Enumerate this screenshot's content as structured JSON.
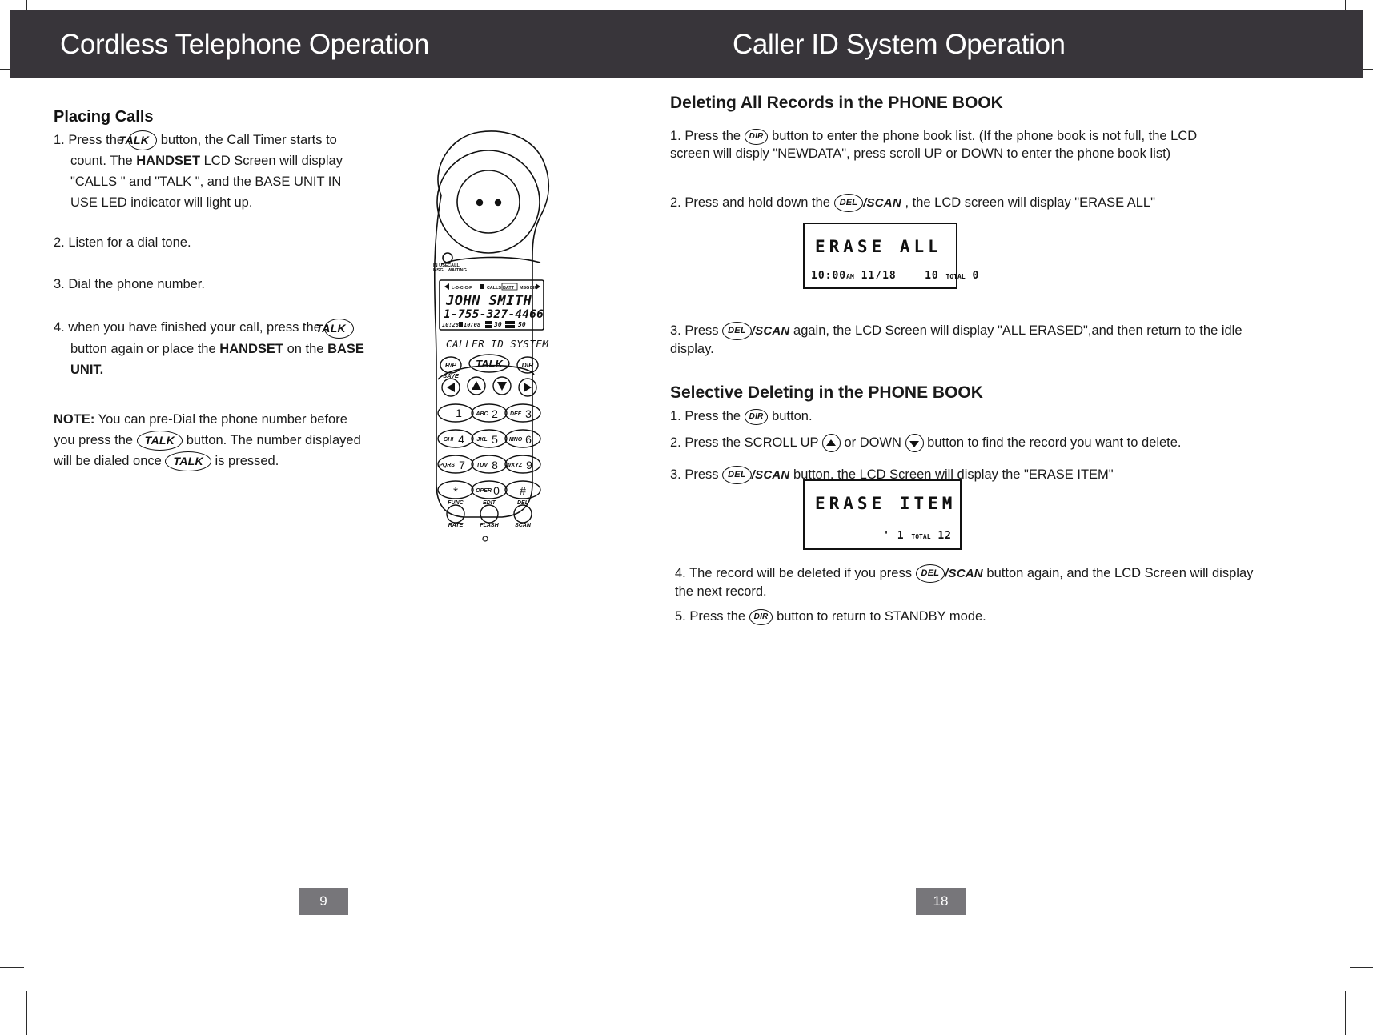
{
  "headers": {
    "left": "Cordless Telephone Operation",
    "right": "Caller ID System Operation"
  },
  "left_page": {
    "section_title": "Placing Calls",
    "step1": {
      "num": "1.",
      "a": "Press the",
      "btn": "TALK",
      "b": "button,   the   Call   Timer starts to count. The",
      "bold1": "HANDSET",
      "c": "LCD Screen will display \"CALLS \"  and  \"TALK \", and  the BASE  UNIT  IN USE LED indicator will light up."
    },
    "step2": "2. Listen for a dial tone.",
    "step3": "3. Dial the phone number.",
    "step4": {
      "num": "4.",
      "a": "when you have finished your call, press the",
      "btn": "TALK",
      "b": "button again or place the",
      "bold1": "HANDSET",
      "c": "on the",
      "bold2": "BASE UNIT."
    },
    "note": {
      "label": "NOTE:",
      "a": "You  can  pre-Dial  the phone number before you press the",
      "btn1": "TALK",
      "b": "button. The number displayed will be dialed once",
      "btn2": "TALK",
      "c": "is pressed."
    },
    "page_number": "9"
  },
  "phone": {
    "led_label_line1": "IN USE",
    "led_label_line2": "MSG",
    "led_label_line3": "CALL",
    "led_label_line4": "WAITING",
    "lcd_status_icons": "L-D-C-C-F",
    "lcd_status_calls": "CALLS",
    "lcd_status_batt": "BATT",
    "lcd_status_msg": "MSG",
    "lcd_status_dir": "DIR",
    "lcd_name": "JOHN SMITH",
    "lcd_number": "1-755-327-4466",
    "lcd_date": "10:28",
    "lcd_date2": "10/08",
    "lcd_new": "30",
    "lcd_total": "50",
    "brand_line": "CALLER ID SYSTEM",
    "keys": {
      "rp": "R/P",
      "rp_sub": "SAVE",
      "talk": "TALK",
      "dir": "DIR",
      "k1": {
        "alpha": "",
        "digit": "1"
      },
      "k2": {
        "alpha": "ABC",
        "digit": "2"
      },
      "k3": {
        "alpha": "DEF",
        "digit": "3"
      },
      "k4": {
        "alpha": "GHI",
        "digit": "4"
      },
      "k5": {
        "alpha": "JKL",
        "digit": "5"
      },
      "k6": {
        "alpha": "MNO",
        "digit": "6"
      },
      "k7": {
        "alpha": "PQRS",
        "digit": "7"
      },
      "k8": {
        "alpha": "TUV",
        "digit": "8"
      },
      "k9": {
        "alpha": "WXYZ",
        "digit": "9"
      },
      "kstar": {
        "alpha": "",
        "digit": "*"
      },
      "k0": {
        "alpha": "OPER",
        "digit": "0"
      },
      "khash": {
        "alpha": "",
        "digit": "#"
      },
      "sub_star": "FUNC",
      "sub_zero": "EDIT",
      "sub_hash": "DEL",
      "b_rate": "RATE",
      "b_flash": "FLASH",
      "b_scan": "SCAN"
    }
  },
  "right_page": {
    "title1": "Deleting All Records in the PHONE BOOK",
    "r1": {
      "num": "1.",
      "a": "Press the",
      "btn": "DIR",
      "b": "button to enter the phone book list. (If the phone book is not full, the LCD screen will disply \"NEWDATA\", press scroll UP or DOWN to enter the phone book list)"
    },
    "r2": {
      "num": "2.",
      "a": "Press and hold down the",
      "btn": "DEL",
      "suffix": "/SCAN",
      "b": ",  the LCD screen will display  \"ERASE  ALL\""
    },
    "lcd1": {
      "main": "ERASE ALL",
      "time": "10:00",
      "ampm": "AM",
      "date": "11/18",
      "new": "10",
      "new_label": "TOTAL",
      "total": "0"
    },
    "r3": {
      "num": "3.",
      "a": "Press",
      "btn": "DEL",
      "suffix": "/SCAN",
      "b": "again,  the LCD Screen will display \"ALL ERASED\",and then return to the idle display."
    },
    "title2": "Selective Deleting in the PHONE BOOK",
    "s1": {
      "num": "1.",
      "a": "Press the",
      "btn": "DIR",
      "b": "button."
    },
    "s2": {
      "num": "2.",
      "a": "Press the SCROLL UP",
      "b": "or DOWN",
      "c": "button to find the record you want to delete."
    },
    "s3": {
      "num": "3.",
      "a": "Press",
      "btn": "DEL",
      "suffix": "/SCAN",
      "b": "button, the LCD Screen will display the \"ERASE ITEM\""
    },
    "lcd2": {
      "main": "ERASE ITEM",
      "left": "' 1",
      "mid_label": "TOTAL",
      "right": "12"
    },
    "s4": {
      "num": "4.",
      "a": "The record will be deleted if  you press",
      "btn": "DEL",
      "suffix": "/SCAN",
      "b": "button again, and the LCD Screen will display the next record."
    },
    "s5": {
      "num": "5.",
      "a": "Press the",
      "btn": "DIR",
      "b": "button  to return to STANDBY mode."
    },
    "page_number": "18"
  },
  "colors": {
    "header_bg": "#38353a",
    "page_chip": "#77767a",
    "ink": "#1a1a1a"
  }
}
